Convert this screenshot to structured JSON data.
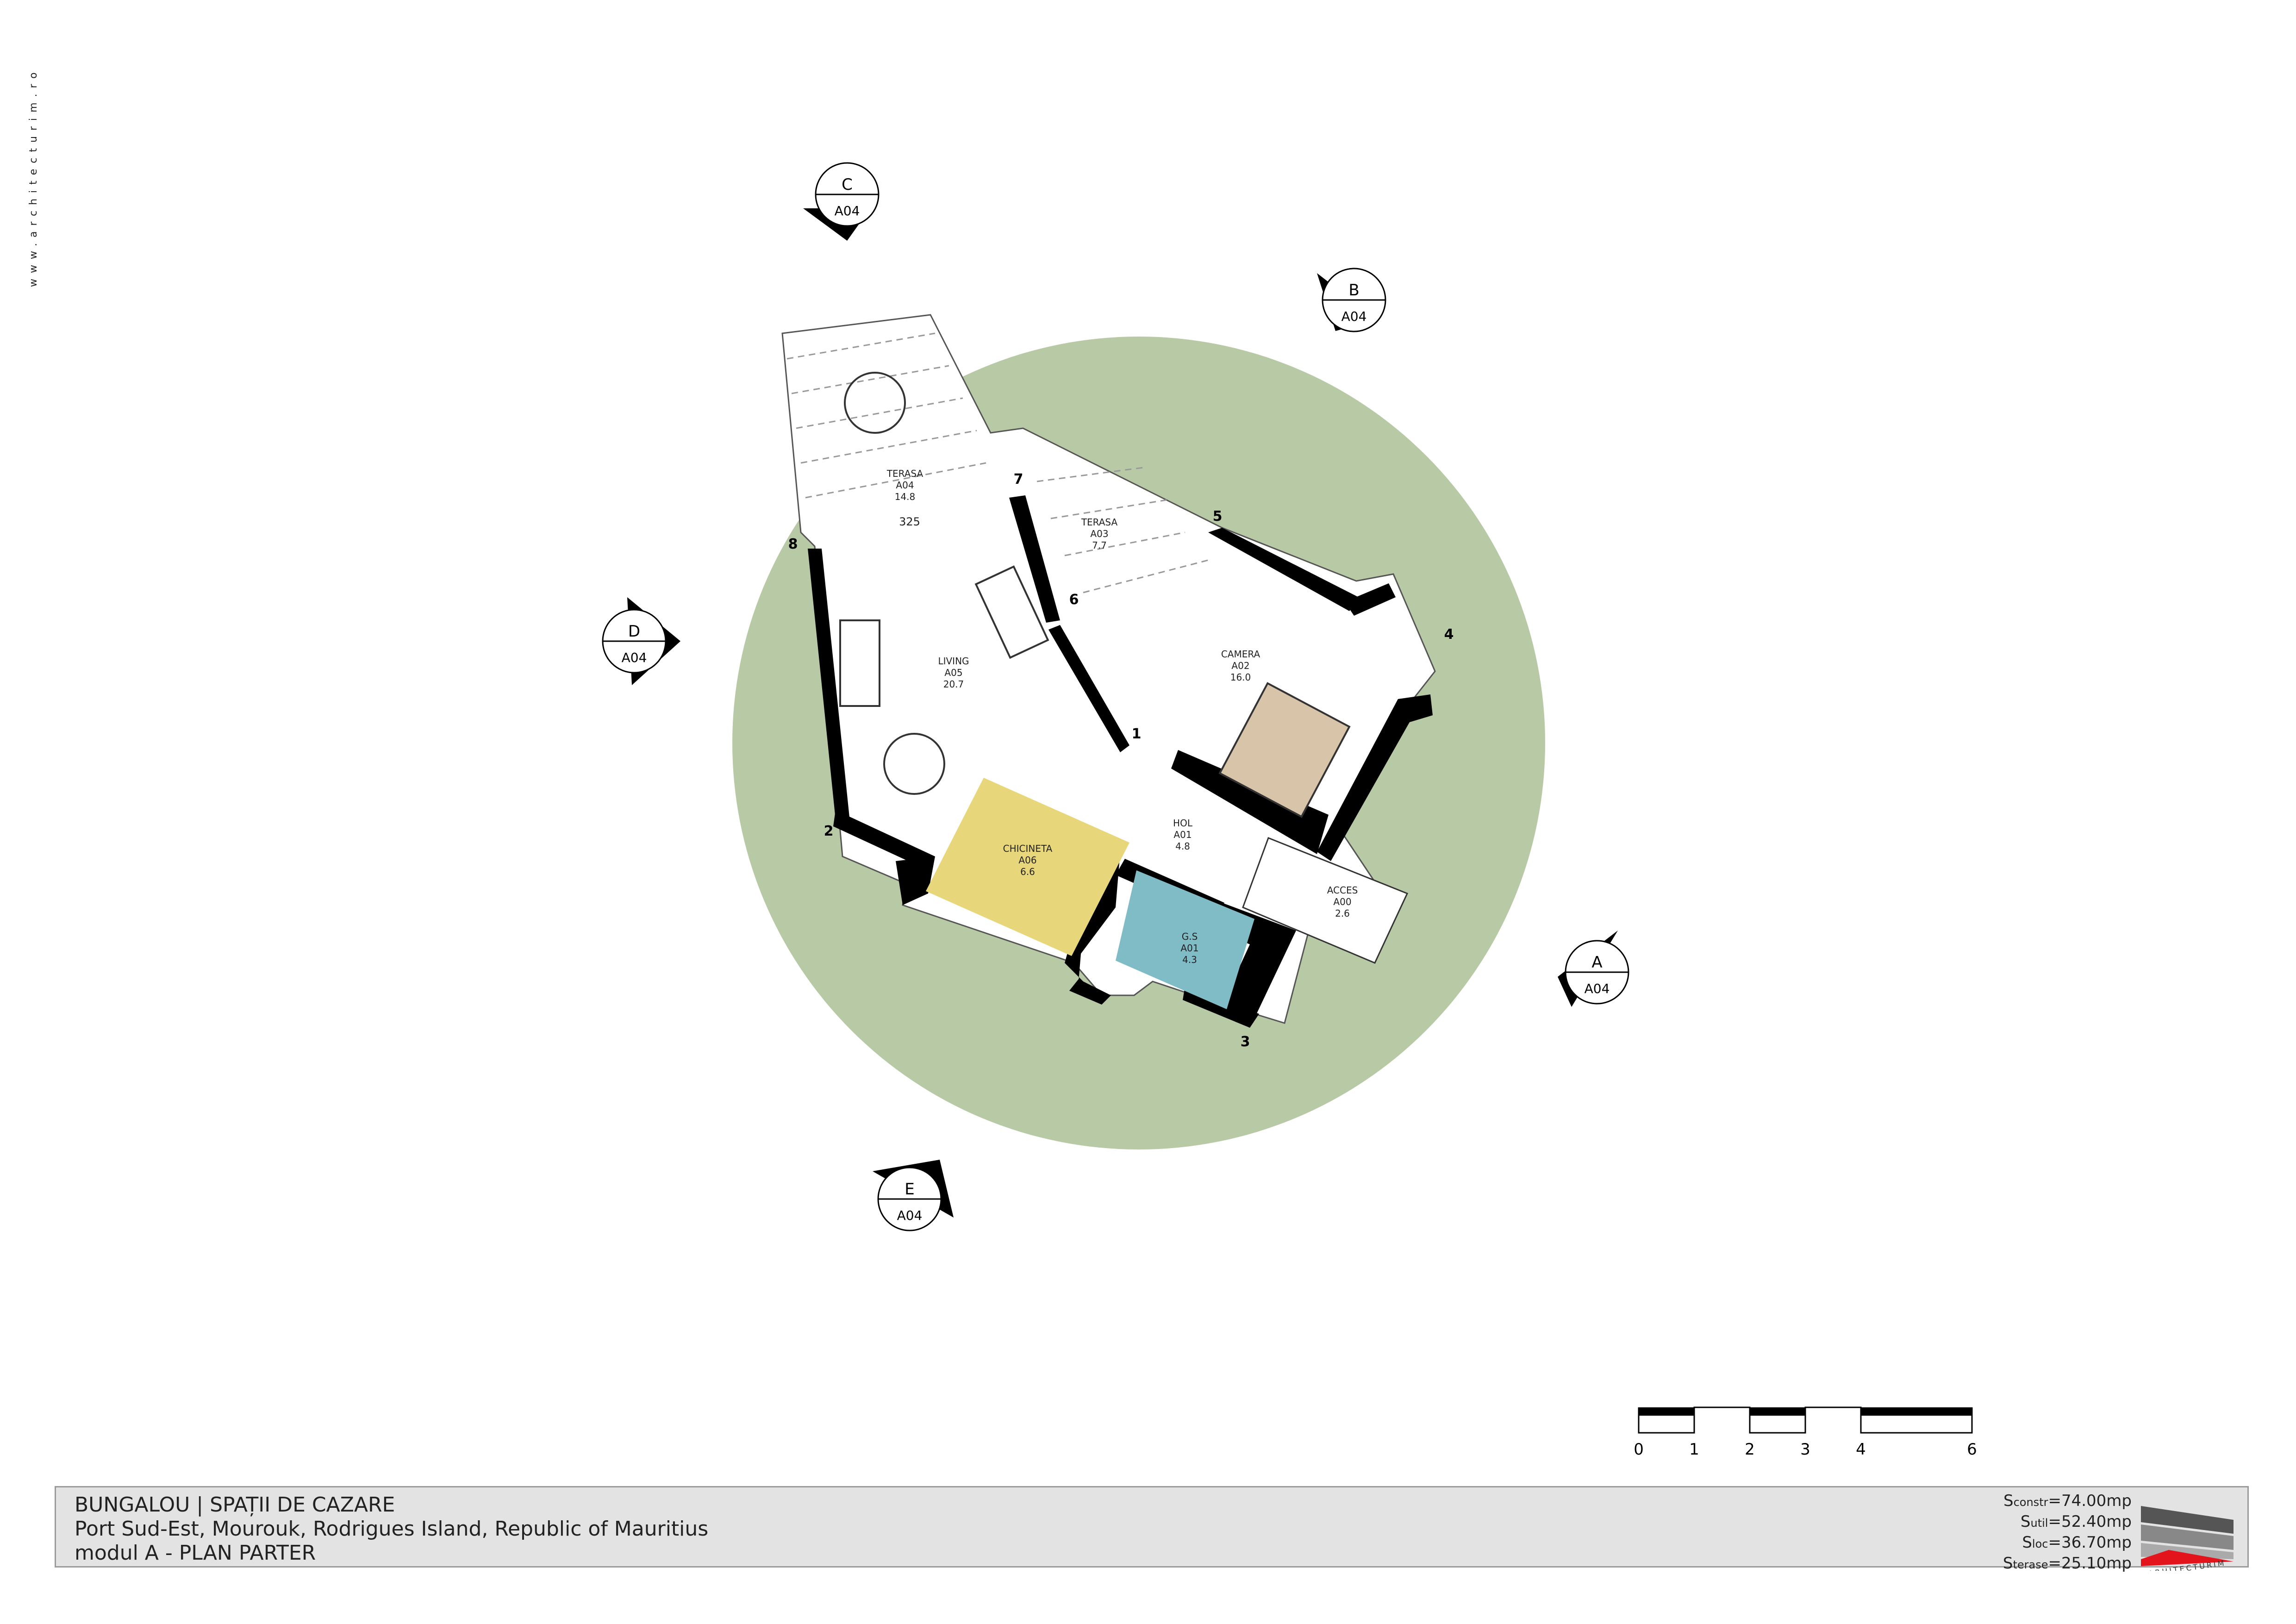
{
  "watermark": "www.architecturim.ro",
  "title_block": {
    "line1": "BUNGALOU | SPAȚII DE CAZARE",
    "line2": "Port Sud-Est, Mourouk, Rodrigues Island, Republic of Mauritius",
    "line3": "modul A - PLAN PARTER",
    "areas": [
      {
        "symbol": "S",
        "sub": "constr",
        "value": "=74.00mp"
      },
      {
        "symbol": "S",
        "sub": "util",
        "value": "=52.40mp"
      },
      {
        "symbol": "S",
        "sub": "loc",
        "value": "=36.70mp"
      },
      {
        "symbol": "S",
        "sub": "terase",
        "value": "=25.10mp"
      }
    ],
    "logo_text": "ARHITECTURIM"
  },
  "scale_bar": {
    "ticks": [
      "0",
      "1",
      "2",
      "3",
      "4",
      "6"
    ]
  },
  "section_markers": [
    {
      "letter": "C",
      "sheet": "A04"
    },
    {
      "letter": "B",
      "sheet": "A04"
    },
    {
      "letter": "D",
      "sheet": "A04"
    },
    {
      "letter": "A",
      "sheet": "A04"
    },
    {
      "letter": "E",
      "sheet": "A04"
    }
  ],
  "rooms": [
    {
      "name": "TERASA",
      "code": "A04",
      "area": "14.8"
    },
    {
      "name": "TERASA",
      "code": "A03",
      "area": "7.7"
    },
    {
      "name": "LIVING",
      "code": "A05",
      "area": "20.7"
    },
    {
      "name": "CAMERA",
      "code": "A02",
      "area": "16.0"
    },
    {
      "name": "CHICINETA",
      "code": "A06",
      "area": "6.6"
    },
    {
      "name": "HOL",
      "code": "A01",
      "area": "4.8"
    },
    {
      "name": "G.S",
      "code": "A01",
      "area": "4.3"
    },
    {
      "name": "ACCES",
      "code": "A00",
      "area": "2.6"
    }
  ],
  "dimension": "325",
  "corner_numbers": [
    "1",
    "2",
    "3",
    "4",
    "5",
    "6",
    "7",
    "8"
  ],
  "colors": {
    "site_circle": "#b8c9a5",
    "kitchen": "#e8d77a",
    "bathroom": "#7fbcc6",
    "walls": "#000000",
    "title_bg": "#e3e3e3"
  }
}
